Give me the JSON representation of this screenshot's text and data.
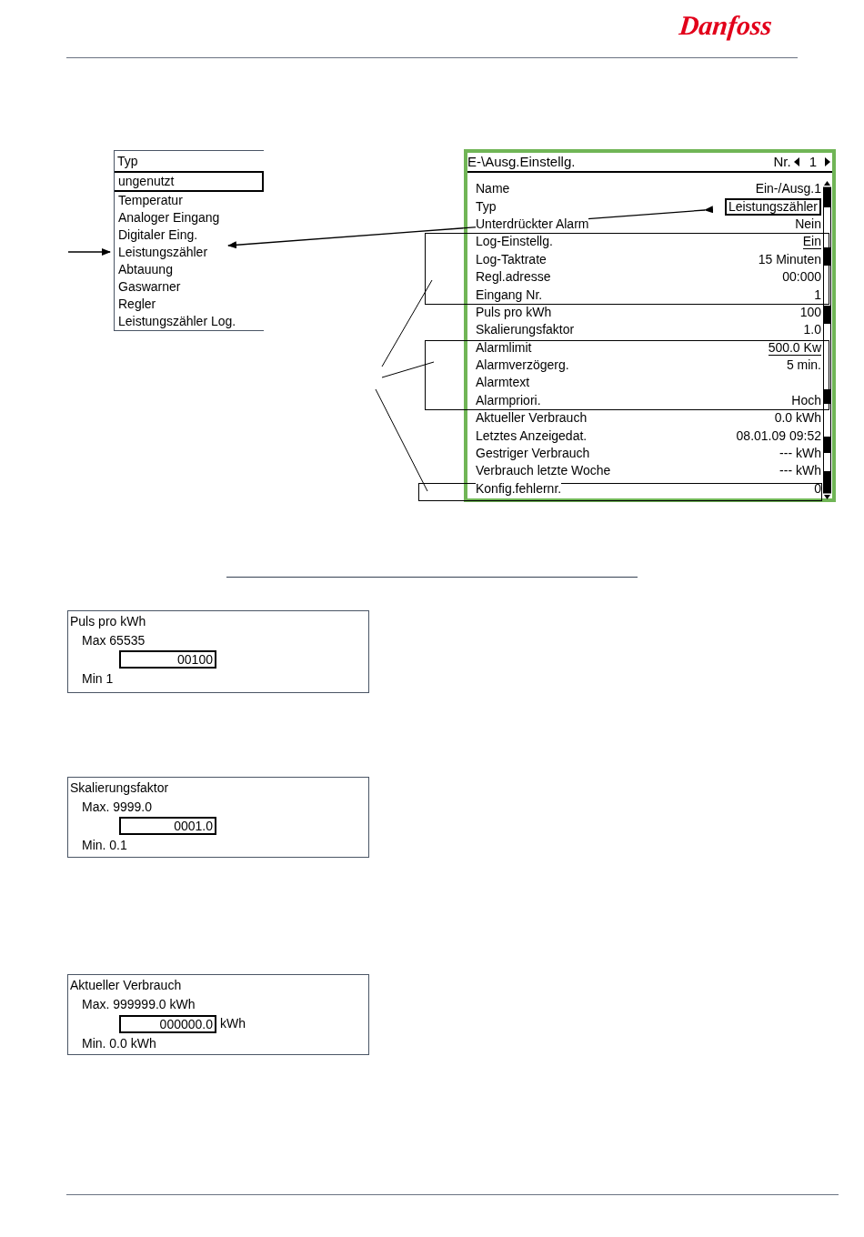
{
  "logo": "Danfoss",
  "type_list": {
    "title": "Typ",
    "items": [
      {
        "label": "ungenutzt",
        "selected": true
      },
      {
        "label": "Temperatur",
        "selected": false
      },
      {
        "label": "Analoger Eingang",
        "selected": false
      },
      {
        "label": "Digitaler Eing.",
        "selected": false
      },
      {
        "label": "Leistungszähler",
        "selected": false
      },
      {
        "label": "Abtauung",
        "selected": false
      },
      {
        "label": "Gaswarner",
        "selected": false
      },
      {
        "label": "Regler",
        "selected": false
      },
      {
        "label": "Leistungszähler Log.",
        "selected": false
      }
    ]
  },
  "settings_panel": {
    "title": "E-\\Ausg.Einstellg.",
    "number_label": "Nr.",
    "number": "1",
    "rows": [
      {
        "label": "Name",
        "value": "Ein-/Ausg.1",
        "kind": "plain"
      },
      {
        "label": "Typ",
        "value": "Leistungszähler",
        "kind": "boxed"
      },
      {
        "label": "Unterdrückter Alarm",
        "value": "Nein",
        "kind": "plain"
      },
      {
        "label": "Log-Einstellg.",
        "value": "Ein",
        "kind": "underlined"
      },
      {
        "label": "Log-Taktrate",
        "value": "15 Minuten",
        "kind": "plain"
      },
      {
        "label": "Regl.adresse",
        "value": "00:000",
        "kind": "plain"
      },
      {
        "label": "Eingang Nr.",
        "value": "1",
        "kind": "plain"
      },
      {
        "label": "Puls pro kWh",
        "value": "100",
        "kind": "plain"
      },
      {
        "label": "Skalierungsfaktor",
        "value": "1.0",
        "kind": "plain"
      },
      {
        "label": "Alarmlimit",
        "value": "500.0 Kw",
        "kind": "underlined"
      },
      {
        "label": "Alarmverzögerg.",
        "value": "5 min.",
        "kind": "plain"
      },
      {
        "label": "Alarmtext",
        "kind": "plain"
      },
      {
        "label": "Alarmpriori.",
        "value": "Hoch",
        "kind": "plain"
      },
      {
        "label": "Aktueller Verbrauch",
        "value": "0.0 kWh",
        "kind": "plain"
      },
      {
        "label": "Letztes Anzeigedat.",
        "value": "08.01.09 09:52",
        "kind": "plain"
      },
      {
        "label": "Gestriger Verbrauch",
        "value": "--- kWh",
        "kind": "plain"
      },
      {
        "label": "Verbrauch letzte Woche",
        "value": "--- kWh",
        "kind": "plain"
      },
      {
        "label": "Konfig.fehlernr.",
        "value": "0",
        "kind": "plain"
      }
    ]
  },
  "dialogs": [
    {
      "title": "Puls pro kWh",
      "max": "Max 65535",
      "value": "00100",
      "min": "Min 1"
    },
    {
      "title": "Skalierungsfaktor",
      "max": "Max. 9999.0",
      "value": "0001.0",
      "min": "Min. 0.1"
    },
    {
      "title": "Aktueller Verbrauch",
      "max": "Max. 999999.0 kWh",
      "value": "000000.0",
      "unit": "kWh",
      "min": "Min. 0.0 kWh"
    }
  ]
}
